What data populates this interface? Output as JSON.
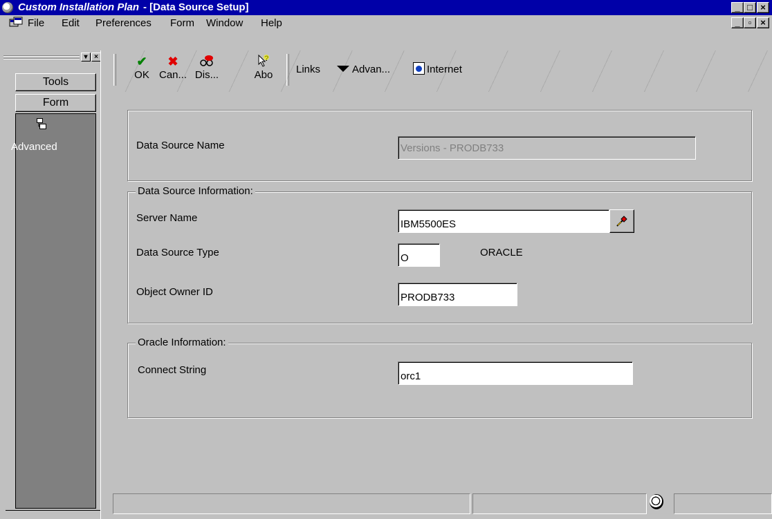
{
  "window": {
    "app_title": "Custom Installation Plan",
    "doc_title": "- [Data Source Setup]",
    "min_symbol": "_",
    "max_symbol": "□",
    "close_symbol": "×",
    "restore_symbol": "▫"
  },
  "menu": {
    "items": [
      {
        "label": "File"
      },
      {
        "label": "Edit"
      },
      {
        "label": "Preferences"
      },
      {
        "label": "Form"
      },
      {
        "label": "Window"
      },
      {
        "label": "Help"
      }
    ]
  },
  "left_pane": {
    "buttons": [
      {
        "label": "Tools"
      },
      {
        "label": "Form"
      }
    ],
    "advanced_label": "Advanced",
    "small_btn_1": "▾",
    "small_btn_2": "×"
  },
  "toolbar": {
    "tools": [
      {
        "label": "OK",
        "icon": "check-icon"
      },
      {
        "label": "Can...",
        "icon": "cancel-icon"
      },
      {
        "label": "Dis...",
        "icon": "display-icon"
      },
      {
        "label": "Abo",
        "icon": "about-icon"
      }
    ],
    "links_label": "Links",
    "advan_label": "Advan...",
    "internet_label": "Internet",
    "colors": {
      "ok": "#008000",
      "cancel": "#e00000"
    }
  },
  "form": {
    "data_source_name": {
      "label": "Data Source Name",
      "value": "Versions - PRODB733"
    },
    "info_group": {
      "title": "Data Source Information:",
      "server_name": {
        "label": "Server Name",
        "value": "IBM5500ES"
      },
      "data_source_type": {
        "label": "Data Source Type",
        "value": "O",
        "description": "ORACLE"
      },
      "object_owner_id": {
        "label": "Object Owner ID",
        "value": "PRODB733"
      }
    },
    "oracle_group": {
      "title": "Oracle Information:",
      "connect_string": {
        "label": "Connect String",
        "value": "orc1"
      }
    }
  }
}
